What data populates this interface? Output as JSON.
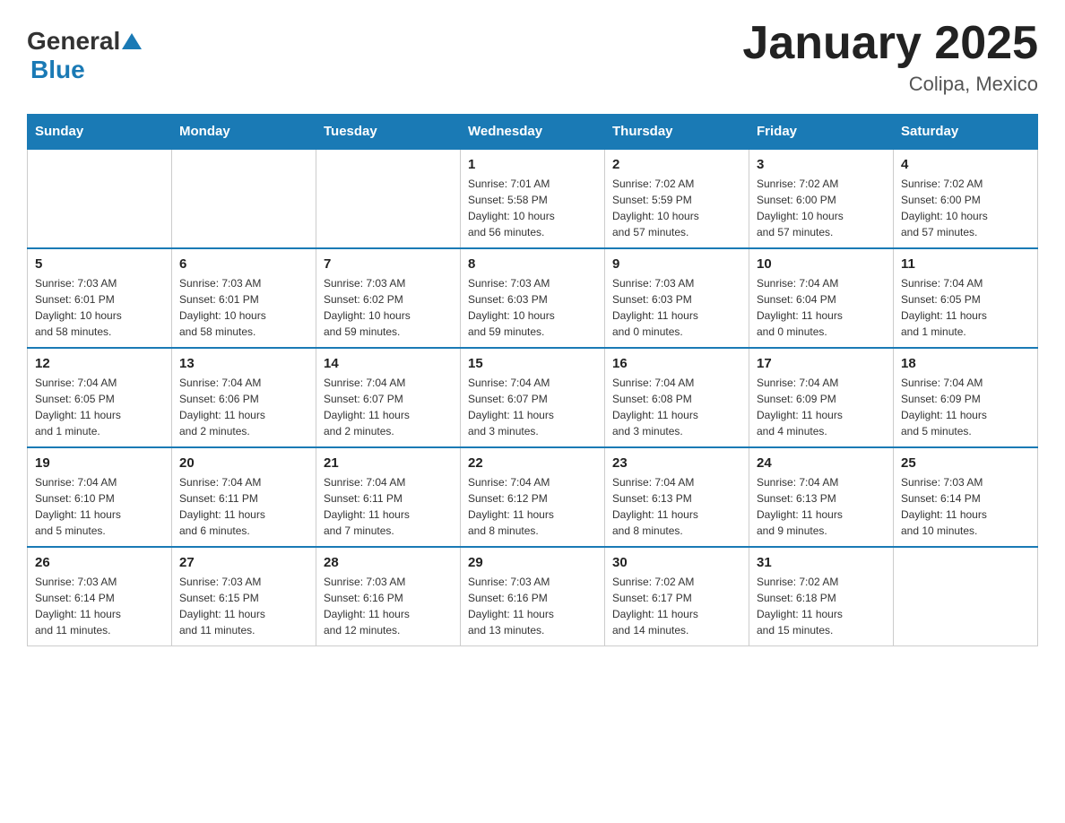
{
  "header": {
    "logo_general": "General",
    "logo_blue": "Blue",
    "title": "January 2025",
    "subtitle": "Colipa, Mexico"
  },
  "weekdays": [
    "Sunday",
    "Monday",
    "Tuesday",
    "Wednesday",
    "Thursday",
    "Friday",
    "Saturday"
  ],
  "weeks": [
    [
      {
        "day": "",
        "info": ""
      },
      {
        "day": "",
        "info": ""
      },
      {
        "day": "",
        "info": ""
      },
      {
        "day": "1",
        "info": "Sunrise: 7:01 AM\nSunset: 5:58 PM\nDaylight: 10 hours\nand 56 minutes."
      },
      {
        "day": "2",
        "info": "Sunrise: 7:02 AM\nSunset: 5:59 PM\nDaylight: 10 hours\nand 57 minutes."
      },
      {
        "day": "3",
        "info": "Sunrise: 7:02 AM\nSunset: 6:00 PM\nDaylight: 10 hours\nand 57 minutes."
      },
      {
        "day": "4",
        "info": "Sunrise: 7:02 AM\nSunset: 6:00 PM\nDaylight: 10 hours\nand 57 minutes."
      }
    ],
    [
      {
        "day": "5",
        "info": "Sunrise: 7:03 AM\nSunset: 6:01 PM\nDaylight: 10 hours\nand 58 minutes."
      },
      {
        "day": "6",
        "info": "Sunrise: 7:03 AM\nSunset: 6:01 PM\nDaylight: 10 hours\nand 58 minutes."
      },
      {
        "day": "7",
        "info": "Sunrise: 7:03 AM\nSunset: 6:02 PM\nDaylight: 10 hours\nand 59 minutes."
      },
      {
        "day": "8",
        "info": "Sunrise: 7:03 AM\nSunset: 6:03 PM\nDaylight: 10 hours\nand 59 minutes."
      },
      {
        "day": "9",
        "info": "Sunrise: 7:03 AM\nSunset: 6:03 PM\nDaylight: 11 hours\nand 0 minutes."
      },
      {
        "day": "10",
        "info": "Sunrise: 7:04 AM\nSunset: 6:04 PM\nDaylight: 11 hours\nand 0 minutes."
      },
      {
        "day": "11",
        "info": "Sunrise: 7:04 AM\nSunset: 6:05 PM\nDaylight: 11 hours\nand 1 minute."
      }
    ],
    [
      {
        "day": "12",
        "info": "Sunrise: 7:04 AM\nSunset: 6:05 PM\nDaylight: 11 hours\nand 1 minute."
      },
      {
        "day": "13",
        "info": "Sunrise: 7:04 AM\nSunset: 6:06 PM\nDaylight: 11 hours\nand 2 minutes."
      },
      {
        "day": "14",
        "info": "Sunrise: 7:04 AM\nSunset: 6:07 PM\nDaylight: 11 hours\nand 2 minutes."
      },
      {
        "day": "15",
        "info": "Sunrise: 7:04 AM\nSunset: 6:07 PM\nDaylight: 11 hours\nand 3 minutes."
      },
      {
        "day": "16",
        "info": "Sunrise: 7:04 AM\nSunset: 6:08 PM\nDaylight: 11 hours\nand 3 minutes."
      },
      {
        "day": "17",
        "info": "Sunrise: 7:04 AM\nSunset: 6:09 PM\nDaylight: 11 hours\nand 4 minutes."
      },
      {
        "day": "18",
        "info": "Sunrise: 7:04 AM\nSunset: 6:09 PM\nDaylight: 11 hours\nand 5 minutes."
      }
    ],
    [
      {
        "day": "19",
        "info": "Sunrise: 7:04 AM\nSunset: 6:10 PM\nDaylight: 11 hours\nand 5 minutes."
      },
      {
        "day": "20",
        "info": "Sunrise: 7:04 AM\nSunset: 6:11 PM\nDaylight: 11 hours\nand 6 minutes."
      },
      {
        "day": "21",
        "info": "Sunrise: 7:04 AM\nSunset: 6:11 PM\nDaylight: 11 hours\nand 7 minutes."
      },
      {
        "day": "22",
        "info": "Sunrise: 7:04 AM\nSunset: 6:12 PM\nDaylight: 11 hours\nand 8 minutes."
      },
      {
        "day": "23",
        "info": "Sunrise: 7:04 AM\nSunset: 6:13 PM\nDaylight: 11 hours\nand 8 minutes."
      },
      {
        "day": "24",
        "info": "Sunrise: 7:04 AM\nSunset: 6:13 PM\nDaylight: 11 hours\nand 9 minutes."
      },
      {
        "day": "25",
        "info": "Sunrise: 7:03 AM\nSunset: 6:14 PM\nDaylight: 11 hours\nand 10 minutes."
      }
    ],
    [
      {
        "day": "26",
        "info": "Sunrise: 7:03 AM\nSunset: 6:14 PM\nDaylight: 11 hours\nand 11 minutes."
      },
      {
        "day": "27",
        "info": "Sunrise: 7:03 AM\nSunset: 6:15 PM\nDaylight: 11 hours\nand 11 minutes."
      },
      {
        "day": "28",
        "info": "Sunrise: 7:03 AM\nSunset: 6:16 PM\nDaylight: 11 hours\nand 12 minutes."
      },
      {
        "day": "29",
        "info": "Sunrise: 7:03 AM\nSunset: 6:16 PM\nDaylight: 11 hours\nand 13 minutes."
      },
      {
        "day": "30",
        "info": "Sunrise: 7:02 AM\nSunset: 6:17 PM\nDaylight: 11 hours\nand 14 minutes."
      },
      {
        "day": "31",
        "info": "Sunrise: 7:02 AM\nSunset: 6:18 PM\nDaylight: 11 hours\nand 15 minutes."
      },
      {
        "day": "",
        "info": ""
      }
    ]
  ]
}
